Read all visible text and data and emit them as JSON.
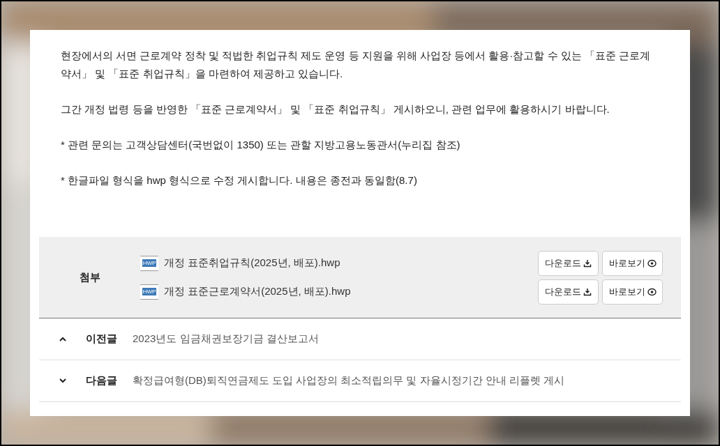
{
  "paragraphs": [
    "현장에서의 서면 근로계약 정착 및 적법한 취업규칙 제도 운영 등 지원을 위해 사업장 등에서 활용·참고할 수 있는 「표준 근로계약서」 및 「표준 취업규칙」을 마련하여 제공하고 있습니다.",
    "그간 개정 법령 등을 반영한 「표준 근로계약서」 및 「표준 취업규칙」 게시하오니, 관련 업무에 활용하시기 바랍니다.",
    "* 관련 문의는 고객상담센터(국번없이 1350) 또는 관할 지방고용노동관서(누리집 참조)",
    "* 한글파일 형식을 hwp 형식으로 수정 게시합니다. 내용은 종전과 동일함(8.7)"
  ],
  "attachment": {
    "label": "첨부",
    "files": [
      {
        "badge": "HWP",
        "name": "개정 표준취업규칙(2025년, 배포).hwp",
        "buttons": [
          {
            "kind": "download",
            "label": "다운로드"
          },
          {
            "kind": "preview",
            "label": "바로보기"
          }
        ]
      },
      {
        "badge": "HWP",
        "name": "개정 표준근로계약서(2025년, 배포).hwp",
        "buttons": [
          {
            "kind": "download",
            "label": "다운로드"
          },
          {
            "kind": "preview",
            "label": "바로보기"
          }
        ]
      }
    ]
  },
  "nav": [
    {
      "kind": "prev",
      "label": "이전글",
      "title": "2023년도 임금채권보장기금 결산보고서"
    },
    {
      "kind": "next",
      "label": "다음글",
      "title": "확정급여형(DB)퇴직연금제도 도입 사업장의 최소적립의무 및 자율시정기간 안내 리플렛 게시"
    }
  ]
}
